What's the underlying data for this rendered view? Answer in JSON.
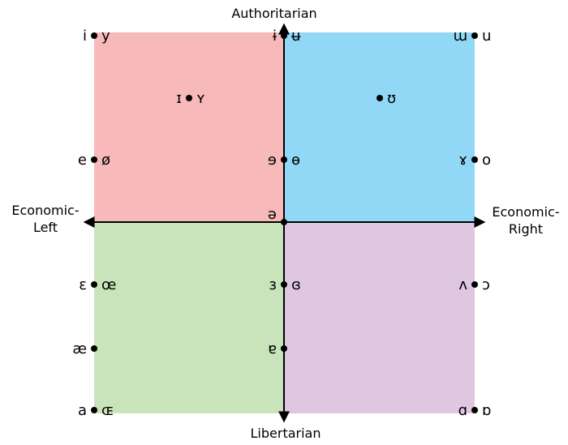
{
  "axes": {
    "top": "Authoritarian",
    "bottom": "Libertarian",
    "left": [
      "Economic-",
      "Left"
    ],
    "right": [
      "Economic-",
      "Right"
    ]
  },
  "quadrant_colors": {
    "top_left": "#f7b9b9",
    "top_right": "#91d8f6",
    "bottom_left": "#c9e3bb",
    "bottom_right": "#dfc7e1"
  },
  "vowels": [
    {
      "id": "close-front",
      "left": "i",
      "right": "y"
    },
    {
      "id": "close-central",
      "left": "ɨ",
      "right": "ʉ"
    },
    {
      "id": "close-back",
      "left": "ɯ",
      "right": "u"
    },
    {
      "id": "near-close-front",
      "left": "ɪ",
      "right": "ʏ"
    },
    {
      "id": "near-close-back",
      "left": "",
      "right": "ʊ"
    },
    {
      "id": "close-mid-front",
      "left": "e",
      "right": "ø"
    },
    {
      "id": "close-mid-central",
      "left": "ɘ",
      "right": "ɵ"
    },
    {
      "id": "close-mid-back",
      "left": "ɤ",
      "right": "o"
    },
    {
      "id": "mid-central",
      "left": "ə",
      "right": ""
    },
    {
      "id": "open-mid-front",
      "left": "ɛ",
      "right": "œ"
    },
    {
      "id": "open-mid-central",
      "left": "ɜ",
      "right": "ɞ"
    },
    {
      "id": "open-mid-back",
      "left": "ʌ",
      "right": "ɔ"
    },
    {
      "id": "near-open-front",
      "left": "æ",
      "right": ""
    },
    {
      "id": "near-open-central",
      "left": "ɐ",
      "right": ""
    },
    {
      "id": "open-front",
      "left": "a",
      "right": "ɶ"
    },
    {
      "id": "open-back",
      "left": "ɑ",
      "right": "ɒ"
    }
  ]
}
